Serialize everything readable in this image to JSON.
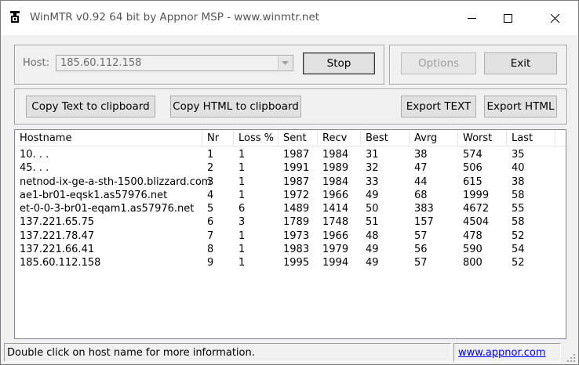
{
  "window": {
    "title": "WinMTR v0.92 64 bit by Appnor MSP - www.winmtr.net"
  },
  "host": {
    "label": "Host:",
    "value": "185.60.112.158"
  },
  "buttons": {
    "stop": "Stop",
    "options": "Options",
    "exit": "Exit",
    "copy_text": "Copy Text to clipboard",
    "copy_html": "Copy HTML to clipboard",
    "export_text": "Export TEXT",
    "export_html": "Export HTML"
  },
  "table": {
    "columns": [
      "Hostname",
      "Nr",
      "Loss %",
      "Sent",
      "Recv",
      "Best",
      "Avrg",
      "Worst",
      "Last"
    ],
    "rows": [
      [
        "10.    .    .",
        "1",
        "1",
        "1987",
        "1984",
        "31",
        "38",
        "574",
        "35"
      ],
      [
        "45.    .    .",
        "2",
        "1",
        "1991",
        "1989",
        "32",
        "47",
        "506",
        "40"
      ],
      [
        "netnod-ix-ge-a-sth-1500.blizzard.com",
        "3",
        "1",
        "1987",
        "1984",
        "33",
        "44",
        "615",
        "38"
      ],
      [
        "ae1-br01-eqsk1.as57976.net",
        "4",
        "1",
        "1972",
        "1966",
        "49",
        "68",
        "1999",
        "58"
      ],
      [
        "et-0-0-3-br01-eqam1.as57976.net",
        "5",
        "6",
        "1489",
        "1414",
        "50",
        "383",
        "4672",
        "55"
      ],
      [
        "137.221.65.75",
        "6",
        "3",
        "1789",
        "1748",
        "51",
        "157",
        "4504",
        "58"
      ],
      [
        "137.221.78.47",
        "7",
        "1",
        "1973",
        "1966",
        "48",
        "57",
        "478",
        "52"
      ],
      [
        "137.221.66.41",
        "8",
        "1",
        "1983",
        "1979",
        "49",
        "56",
        "590",
        "54"
      ],
      [
        "185.60.112.158",
        "9",
        "1",
        "1995",
        "1994",
        "49",
        "57",
        "800",
        "52"
      ]
    ]
  },
  "status": {
    "message": "Double click on host name for more information.",
    "link": "www.appnor.com"
  }
}
